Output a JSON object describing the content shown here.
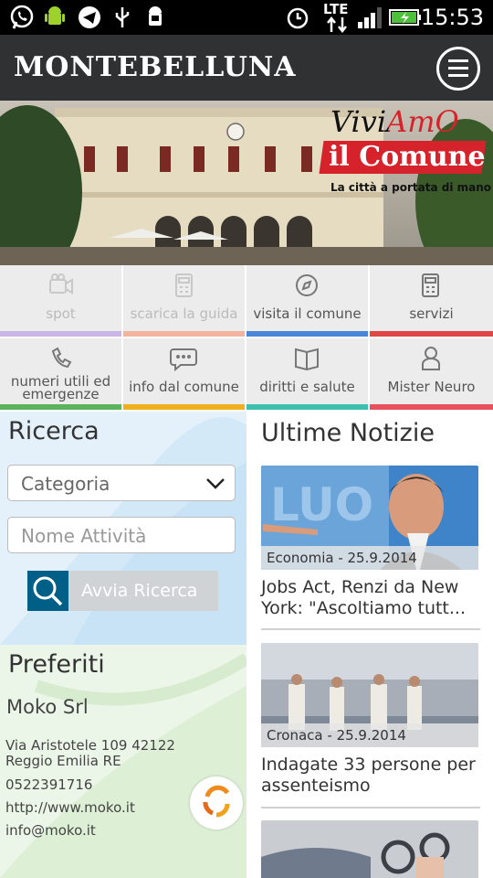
{
  "status_bar": {
    "time": "15:53",
    "network": "LTE",
    "icons": [
      "whatsapp-icon",
      "android-icon",
      "telegram-icon",
      "usb-icon",
      "android-debug-icon",
      "alarm-icon",
      "signal-icon",
      "battery-icon"
    ]
  },
  "header": {
    "title": "MONTEBELLUNA",
    "menu_icon": "hamburger-icon"
  },
  "banner": {
    "line1": "ViviAmO",
    "line2": "il Comune",
    "tagline": "La città a portata di mano"
  },
  "tiles": [
    {
      "label": "spot",
      "icon": "camera-icon",
      "color": "#c9b6e6",
      "enabled": false
    },
    {
      "label": "scarica la guida",
      "icon": "calculator-icon",
      "color": "#f2b49e",
      "enabled": false
    },
    {
      "label": "visita il comune",
      "icon": "compass-icon",
      "color": "#4a86d8",
      "enabled": true
    },
    {
      "label": "servizi",
      "icon": "calculator-icon",
      "color": "#e04646",
      "enabled": true
    },
    {
      "label": "numeri utili ed emergenze",
      "icon": "phone-icon",
      "color": "#5bb35b",
      "enabled": true
    },
    {
      "label": "info dal comune",
      "icon": "chat-icon",
      "color": "#f0b01e",
      "enabled": true
    },
    {
      "label": "diritti e salute",
      "icon": "book-icon",
      "color": "#3dbfae",
      "enabled": true
    },
    {
      "label": "Mister Neuro",
      "icon": "person-icon",
      "color": "#e8505b",
      "enabled": true
    }
  ],
  "search": {
    "title": "Ricerca",
    "category": "Categoria",
    "name_placeholder": "Nome Attività",
    "button": "Avvia Ricerca"
  },
  "favorites": {
    "title": "Preferiti",
    "name": "Moko Srl",
    "address1": "Via Aristotele 109 42122",
    "address2": "Reggio Emilia RE",
    "phone": "0522391716",
    "web": "http://www.moko.it",
    "email": "info@moko.it"
  },
  "news": {
    "title": "Ultime Notizie",
    "items": [
      {
        "tag": "Economia - 25.9.2014",
        "title": "Jobs Act, Renzi da New York: \"Ascoltiamo tutt..."
      },
      {
        "tag": "Cronaca - 25.9.2014",
        "title": "Indagate 33 persone per assenteismo"
      }
    ]
  }
}
